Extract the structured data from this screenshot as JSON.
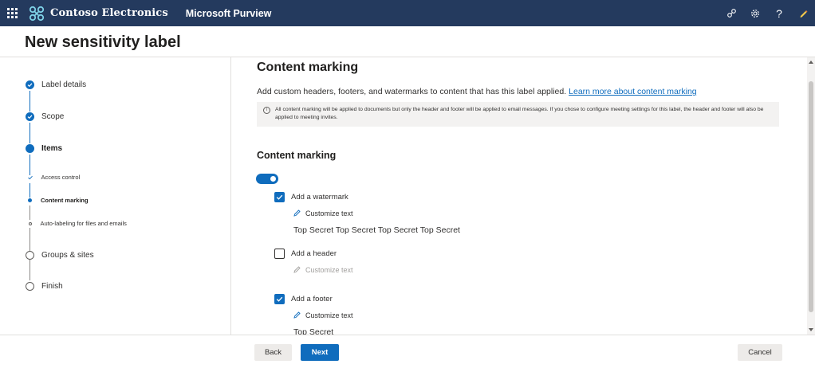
{
  "topbar": {
    "org_name": "Contoso Electronics",
    "app_name": "Microsoft Purview",
    "icons": [
      "waffle-icon",
      "contoso-logo",
      "link-icon",
      "gear-icon",
      "help-icon",
      "pen-icon"
    ],
    "help_glyph": "?"
  },
  "page": {
    "title": "New sensitivity label"
  },
  "steps": [
    {
      "label": "Label details",
      "state": "done"
    },
    {
      "label": "Scope",
      "state": "done"
    },
    {
      "label": "Items",
      "state": "current"
    },
    {
      "label": "Access control",
      "state": "done-sub"
    },
    {
      "label": "Content marking",
      "state": "current-sub"
    },
    {
      "label": "Auto-labeling for files and emails",
      "state": "todo-sub"
    },
    {
      "label": "Groups & sites",
      "state": "todo"
    },
    {
      "label": "Finish",
      "state": "todo"
    }
  ],
  "content": {
    "title": "Content marking",
    "description": "Add custom headers, footers, and watermarks to content that has this label applied.",
    "learn_more": "Learn more about content marking",
    "info": "All content marking will be applied to documents but only the header and footer will be applied to email messages. If you chose to configure meeting settings for this label, the header and footer will also be applied to meeting invites.",
    "section_title": "Content marking",
    "toggle_on": true,
    "watermark": {
      "label": "Add a watermark",
      "checked": true,
      "customize": "Customize text",
      "text": "Top Secret Top Secret Top Secret Top Secret"
    },
    "header": {
      "label": "Add a header",
      "checked": false,
      "customize": "Customize text"
    },
    "footer": {
      "label": "Add a footer",
      "checked": true,
      "customize": "Customize text",
      "text": "Top Secret"
    }
  },
  "footer": {
    "back": "Back",
    "next": "Next",
    "cancel": "Cancel"
  },
  "colors": {
    "topbar": "#243a5e",
    "accent": "#0f6cbd"
  }
}
